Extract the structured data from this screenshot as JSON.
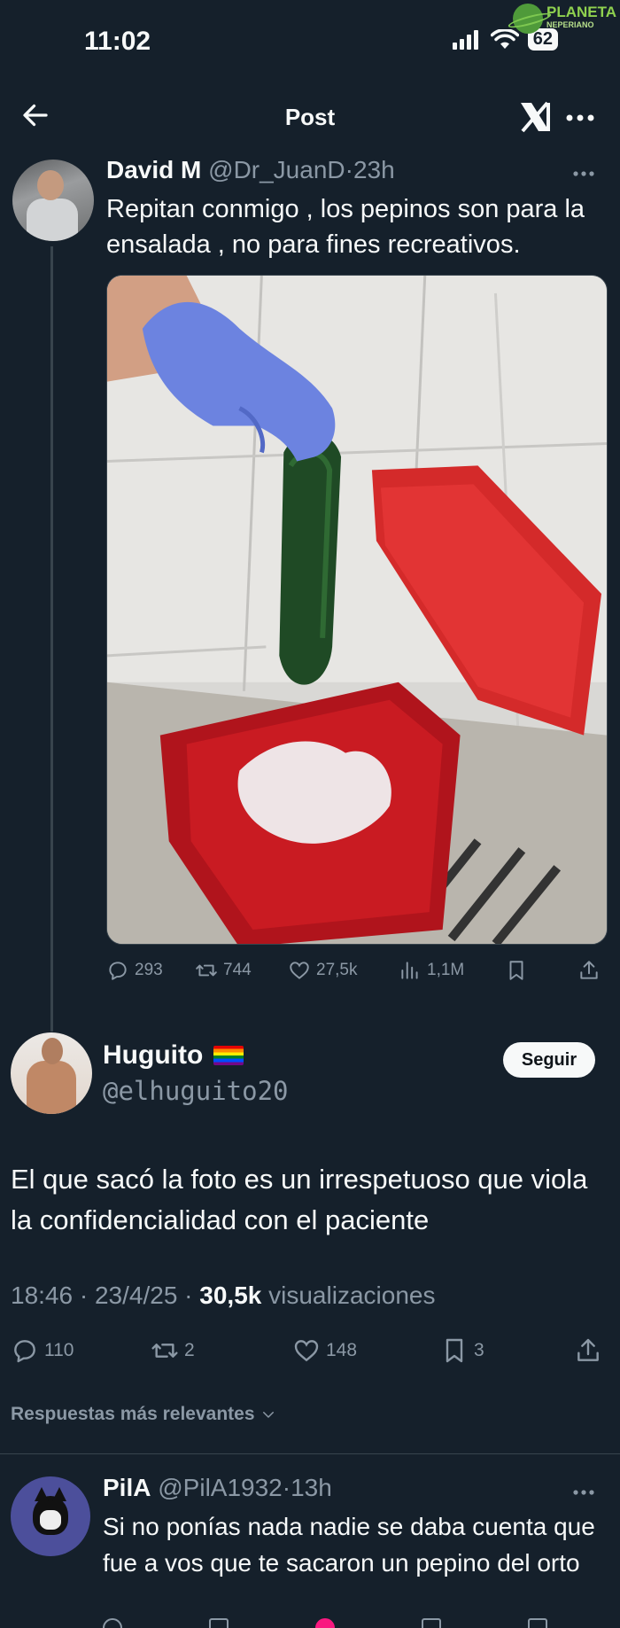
{
  "status_bar": {
    "time": "11:02",
    "battery": "62",
    "icons": [
      "signal-icon",
      "wifi-icon",
      "battery-icon"
    ]
  },
  "watermark": {
    "line1": "PLANETA",
    "line2": "NEPERIANO"
  },
  "header": {
    "title": "Post",
    "icons": [
      "back-arrow-icon",
      "x-logo-icon",
      "more-icon"
    ]
  },
  "quoted_tweet": {
    "name": "David M",
    "handle": "@Dr_JuanD",
    "separator": "·",
    "time": "23h",
    "text": "Repitan conmigo , los pepinos son para la ensalada , no para fines recreativos.",
    "actions": {
      "replies": "293",
      "retweets": "744",
      "likes": "27,5k",
      "views": "1,1M"
    }
  },
  "main_tweet": {
    "name": "Huguito",
    "handle": "@elhuguito20",
    "follow_label": "Seguir",
    "text": "El que sacó la foto es un irrespetuoso que viola la confidencialidad con el paciente",
    "meta": {
      "time": "18:46",
      "separator": " · ",
      "date": "23/4/25",
      "views_count": "30,5k",
      "views_label": "visualizaciones"
    },
    "actions": {
      "replies": "110",
      "retweets": "2",
      "likes": "148",
      "bookmarks": "3"
    }
  },
  "replies_filter": {
    "label": "Respuestas más relevantes"
  },
  "reply": {
    "name": "PilA",
    "handle": "@PilA1932",
    "separator": "·",
    "time": "13h",
    "text": "Si no ponías nada nadie se daba cuenta que fue a vos que te sacaron un pepino del orto"
  },
  "colors": {
    "background": "#15202b",
    "text": "#f7f9f9",
    "muted": "#8b98a5",
    "border": "#38444d",
    "like_pink": "#f91880"
  }
}
